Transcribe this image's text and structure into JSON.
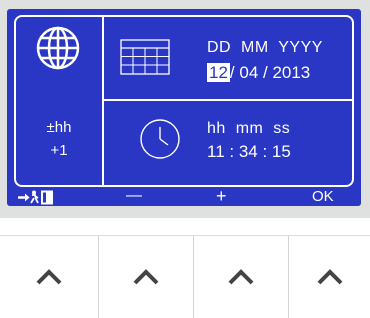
{
  "timezone": {
    "label": "±hh",
    "value": "+1"
  },
  "date": {
    "header": "DD  MM  YYYY",
    "day": "12",
    "month_part": "/ 04 / 2013"
  },
  "time": {
    "header": "hh  mm  ss",
    "value": "11 : 34 : 15"
  },
  "softkeys": {
    "minus": "—",
    "plus": "+",
    "ok": "OK"
  },
  "colors": {
    "screen": "#2a36c4",
    "text": "#ffffff",
    "bezel": "#dfe0e0",
    "key_icon": "#444444"
  },
  "icons": [
    "globe-icon",
    "calendar-icon",
    "clock-icon",
    "exit-icon",
    "chevron-up-icon"
  ]
}
